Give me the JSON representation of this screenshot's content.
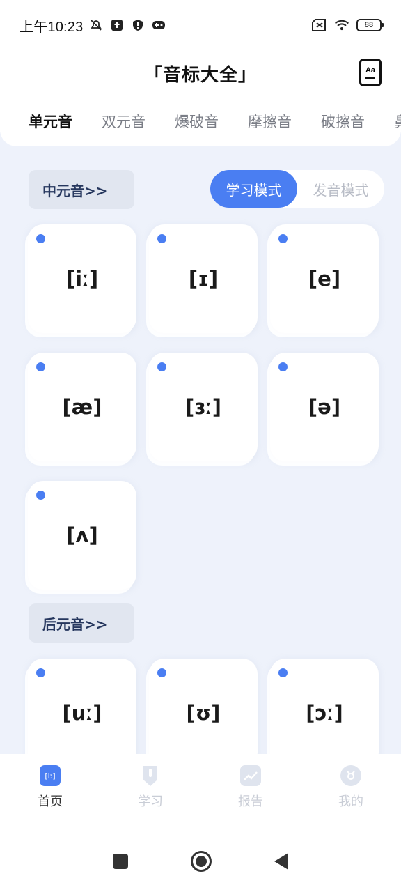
{
  "status_bar": {
    "time": "上午10:23",
    "battery": "88",
    "icons": [
      "mute-bell-icon",
      "upload-icon",
      "shield-icon",
      "gamepad-icon",
      "sim-off-icon",
      "wifi-icon",
      "battery-icon"
    ]
  },
  "header": {
    "title": "「音标大全」",
    "font_button_label": "Aa"
  },
  "tabs": [
    {
      "label": "单元音",
      "active": true
    },
    {
      "label": "双元音",
      "active": false
    },
    {
      "label": "爆破音",
      "active": false
    },
    {
      "label": "摩擦音",
      "active": false
    },
    {
      "label": "破擦音",
      "active": false
    },
    {
      "label": "鼻",
      "active": false
    }
  ],
  "mode_toggle": {
    "study": "学习模式",
    "pronounce": "发音模式",
    "selected": "study"
  },
  "sections": [
    {
      "label": "中元音>>",
      "cards": [
        "[iː]",
        "[ɪ]",
        "[e]",
        "[æ]",
        "[ɜː]",
        "[ə]",
        "[ʌ]"
      ]
    },
    {
      "label": "后元音>>",
      "cards": [
        "[uː]",
        "[ʊ]",
        "[ɔː]"
      ]
    }
  ],
  "bottom_nav": [
    {
      "label": "首页",
      "icon": "home-phonetic-icon",
      "icon_text": "[iː]",
      "active": true
    },
    {
      "label": "学习",
      "icon": "pencil-icon",
      "active": false
    },
    {
      "label": "报告",
      "icon": "chart-icon",
      "active": false
    },
    {
      "label": "我的",
      "icon": "profile-icon",
      "active": false
    }
  ],
  "colors": {
    "accent": "#4a7ef2",
    "background": "#eef2fb",
    "section_label_bg": "#e1e6f0",
    "section_label_text": "#26375e"
  }
}
